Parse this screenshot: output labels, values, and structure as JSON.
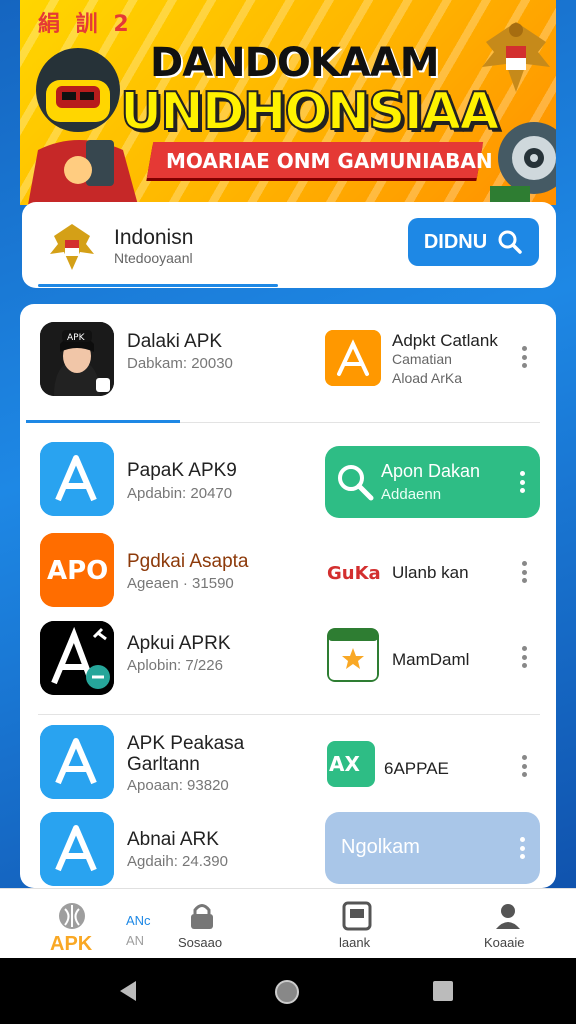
{
  "banner": {
    "corner_text": "絹 訓 2",
    "title_line1": "DANDOKAAM",
    "title_line2": "UNDHONSIAA",
    "ribbon_text": "MOARIAE ONM GAMUNIABAN"
  },
  "search_card": {
    "country_name": "Indonisn",
    "country_sub": "Ntedooyaanl",
    "button_label": "DIDNU"
  },
  "apps_left": [
    {
      "title": "Dalaki APK",
      "meta": "Dabkam: 20030",
      "icon_text": "APK"
    },
    {
      "title": "PapaK APK9",
      "meta": "Apdabin: 20470"
    },
    {
      "title": "Pgdkai Asapta",
      "meta": "Ageaen · 31590",
      "icon_text": "APO"
    },
    {
      "title": "Apkui APRK",
      "meta": "Aplobin: 7/226"
    },
    {
      "title": "APK Peakasa\nGarltann",
      "meta": "Apoaan: 93820"
    },
    {
      "title": "Abnai ARK",
      "meta": "Agdaih: 24.390"
    }
  ],
  "apps_right": [
    {
      "title": "Adpkt Catlank",
      "line2": "Camatian",
      "meta": "Aload ArKa",
      "icon_text": "A"
    },
    {
      "title": "Apon Dakan",
      "meta": "Addaenn"
    },
    {
      "title": "Ulanb kan",
      "icon_text": "GuKa"
    },
    {
      "title": "MamDaml"
    },
    {
      "title": "6APPAE",
      "icon_text": "AX"
    },
    {
      "title": "Ngolkam"
    }
  ],
  "bottom_nav": [
    {
      "label": "APK",
      "sub": ""
    },
    {
      "label": "ANc",
      "sub": "AN"
    },
    {
      "label": "Sosaao"
    },
    {
      "label": "laank"
    },
    {
      "label": "Koaaie"
    }
  ],
  "colors": {
    "brand_blue": "#1e88e5",
    "green": "#2ebd85",
    "orange": "#ff7a1a",
    "banner_yellow": "#ffd600"
  }
}
